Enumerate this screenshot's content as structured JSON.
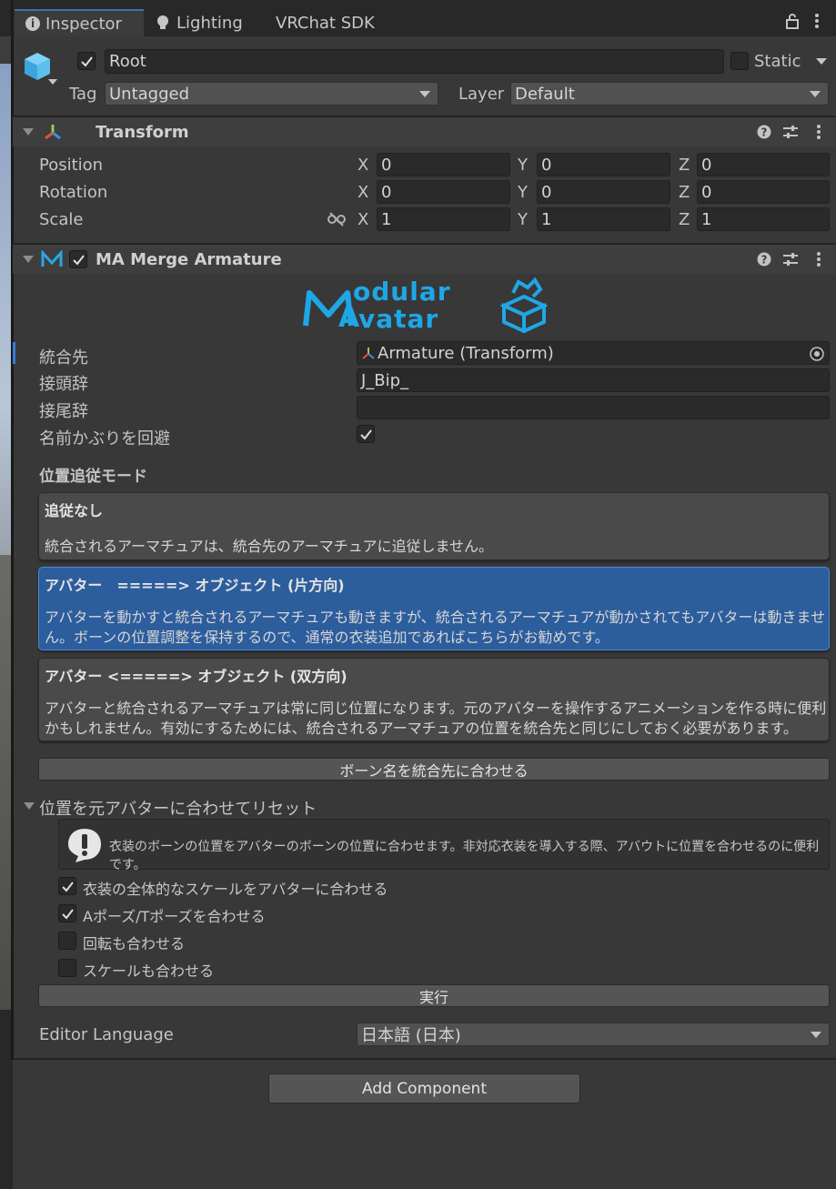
{
  "tabs": [
    {
      "label": "Inspector",
      "icon": "info-icon"
    },
    {
      "label": "Lighting",
      "icon": "bulb-icon"
    },
    {
      "label": "VRChat SDK"
    }
  ],
  "header": {
    "object_name": "Root",
    "active": true,
    "static_label": "Static",
    "tag_label": "Tag",
    "tag_value": "Untagged",
    "layer_label": "Layer",
    "layer_value": "Default"
  },
  "transform": {
    "title": "Transform",
    "rows": [
      {
        "label": "Position",
        "x": "0",
        "y": "0",
        "z": "0"
      },
      {
        "label": "Rotation",
        "x": "0",
        "y": "0",
        "z": "0"
      },
      {
        "label": "Scale",
        "x": "1",
        "y": "1",
        "z": "1"
      }
    ],
    "axis_x": "X",
    "axis_y": "Y",
    "axis_z": "Z"
  },
  "merge_armature": {
    "title": "MA Merge Armature",
    "enabled": true,
    "logo_line1": "odular",
    "logo_line2": "vatar",
    "target_label": "統合先",
    "target_value": "Armature (Transform)",
    "prefix_label": "接頭辞",
    "prefix_value": "J_Bip_",
    "suffix_label": "接尾辞",
    "suffix_value": "",
    "avoid_label": "名前かぶりを回避",
    "avoid_checked": true,
    "mode_heading": "位置追従モード",
    "modes": [
      {
        "title": "追従なし",
        "desc": "統合されるアーマチュアは、統合先のアーマチュアに追従しません。",
        "selected": false
      },
      {
        "title": "アバター　=====> オブジェクト (片方向)",
        "desc": "アバターを動かすと統合されるアーマチュアも動きますが、統合されるアーマチュアが動かされてもアバターは動きません。ボーンの位置調整を保持するので、通常の衣装追加であればこちらがお勧めです。",
        "selected": true
      },
      {
        "title": "アバター <=====> オブジェクト (双方向)",
        "desc": "アバターと統合されるアーマチュアは常に同じ位置になります。元のアバターを操作するアニメーションを作る時に便利かもしれません。有効にするためには、統合されるアーマチュアの位置を統合先と同じにしておく必要があります。",
        "selected": false
      }
    ],
    "match_bone_button": "ボーン名を統合先に合わせる",
    "reset_foldout": "位置を元アバターに合わせてリセット",
    "help_text": "衣装のボーンの位置をアバターのボーンの位置に合わせます。非対応衣装を導入する際、アバウトに位置を合わせるのに便利です。",
    "options": [
      {
        "label": "衣装の全体的なスケールをアバターに合わせる",
        "checked": true
      },
      {
        "label": "Aポーズ/Tポーズを合わせる",
        "checked": true
      },
      {
        "label": "回転も合わせる",
        "checked": false
      },
      {
        "label": "スケールも合わせる",
        "checked": false
      }
    ],
    "run_button": "実行",
    "editor_language_label": "Editor Language",
    "editor_language_value": "日本語 (日本)"
  },
  "add_component_button": "Add Component",
  "colors": {
    "accent": "#2c5d9c",
    "logo": "#1ea7e6",
    "background": "#383838"
  }
}
